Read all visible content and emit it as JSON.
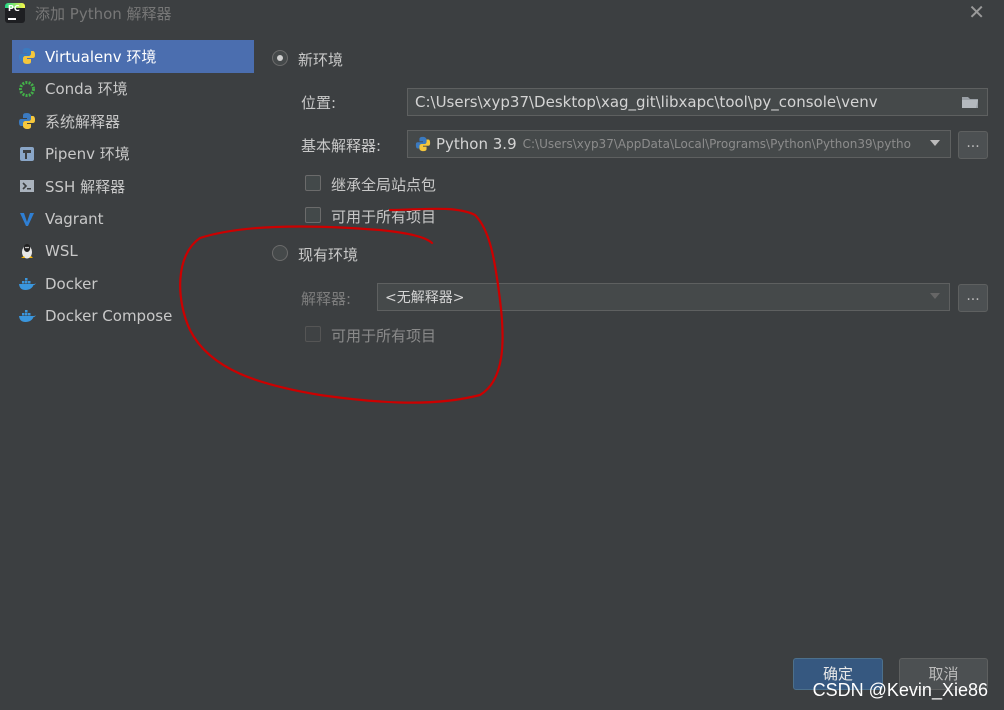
{
  "window": {
    "title": "添加 Python 解释器"
  },
  "sidebar": {
    "items": [
      {
        "label": "Virtualenv 环境",
        "icon": "python-icon",
        "selected": true
      },
      {
        "label": "Conda 环境",
        "icon": "conda-icon"
      },
      {
        "label": "系统解释器",
        "icon": "python-icon"
      },
      {
        "label": "Pipenv 环境",
        "icon": "pipenv-icon"
      },
      {
        "label": "SSH 解释器",
        "icon": "terminal-icon"
      },
      {
        "label": "Vagrant",
        "icon": "vagrant-icon"
      },
      {
        "label": "WSL",
        "icon": "linux-icon"
      },
      {
        "label": "Docker",
        "icon": "docker-icon"
      },
      {
        "label": "Docker Compose",
        "icon": "docker-icon"
      }
    ]
  },
  "new_env": {
    "radio_label": "新环境",
    "selected": true,
    "location_label": "位置:",
    "location_value": "C:\\Users\\xyp37\\Desktop\\xag_git\\libxapc\\tool\\py_console\\venv",
    "base_interp_label": "基本解释器:",
    "base_interp_name": "Python 3.9",
    "base_interp_path": "C:\\Users\\xyp37\\AppData\\Local\\Programs\\Python\\Python39\\pytho",
    "browse_label": "...",
    "inherit_label": "继承全局站点包",
    "all_projects_label": "可用于所有项目"
  },
  "existing_env": {
    "radio_label": "现有环境",
    "interp_label": "解释器:",
    "interp_value": "<无解释器>",
    "browse_label": "...",
    "all_projects_label": "可用于所有项目"
  },
  "buttons": {
    "ok": "确定",
    "cancel": "取消"
  },
  "watermark": "CSDN @Kevin_Xie86",
  "colors": {
    "background": "#3c3f41",
    "selection": "#4b6eaf",
    "annotation": "#cc0000"
  }
}
